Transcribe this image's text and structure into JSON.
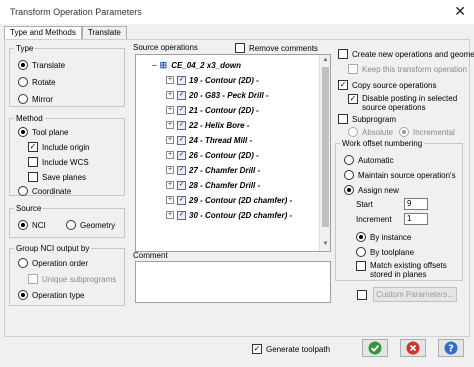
{
  "window": {
    "title": "Transform Operation Parameters",
    "close_glyph": "✕"
  },
  "tabs": [
    {
      "label": "Type and Methods",
      "active": true
    },
    {
      "label": "Translate",
      "active": false
    }
  ],
  "type_group": {
    "label": "Type",
    "options": [
      {
        "label": "Translate",
        "selected": true
      },
      {
        "label": "Rotate",
        "selected": false
      },
      {
        "label": "Mirror",
        "selected": false
      }
    ]
  },
  "method_group": {
    "label": "Method",
    "tool_plane": "Tool plane",
    "include_origin": "Include origin",
    "include_wcs": "Include WCS",
    "save_planes": "Save planes",
    "coordinate": "Coordinate"
  },
  "source_group": {
    "label": "Source",
    "nci": "NCI",
    "geometry": "Geometry"
  },
  "group_nci": {
    "label": "Group NCI output by",
    "operation_order": "Operation order",
    "unique_subprograms": "Unique subprograms",
    "operation_type": "Operation type"
  },
  "source_operations": {
    "label": "Source operations",
    "remove_comments": "Remove comments",
    "root": "CE_04_2 x3_down",
    "items": [
      "19 - Contour (2D) -",
      "20 - G83 - Peck Drill -",
      "21 - Contour (2D) -",
      "22 - Helix Bore -",
      "24 - Thread Mill -",
      "26 - Contour (2D) -",
      "27 - Chamfer Drill -",
      "28 - Chamfer Drill -",
      "29 - Contour (2D chamfer) -",
      "30 - Contour (2D chamfer) -"
    ]
  },
  "comment": {
    "label": "Comment",
    "value": ""
  },
  "right_options": {
    "create_new": "Create new operations and geometry",
    "keep_transform": "Keep this transform operation",
    "copy_source": "Copy source operations",
    "disable_posting": "Disable posting in selected source operations",
    "subprogram": "Subprogram",
    "absolute": "Absolute",
    "incremental": "Incremental"
  },
  "work_offset": {
    "label": "Work offset numbering",
    "maintain": "Maintain source operation's",
    "automatic": "Automatic",
    "assign_new": "Assign new",
    "start_label": "Start",
    "start_value": "9",
    "increment_label": "Increment",
    "increment_value": "1",
    "by_instance": "By instance",
    "by_toolplane": "By toolplane",
    "match_existing": "Match existing offsets stored in planes"
  },
  "custom_parameters": "Custom Parameters...",
  "generate_toolpath": "Generate toolpath",
  "colors": {
    "ok": "#2e9a3c",
    "cancel": "#d1322b",
    "help": "#2d6fc8"
  }
}
